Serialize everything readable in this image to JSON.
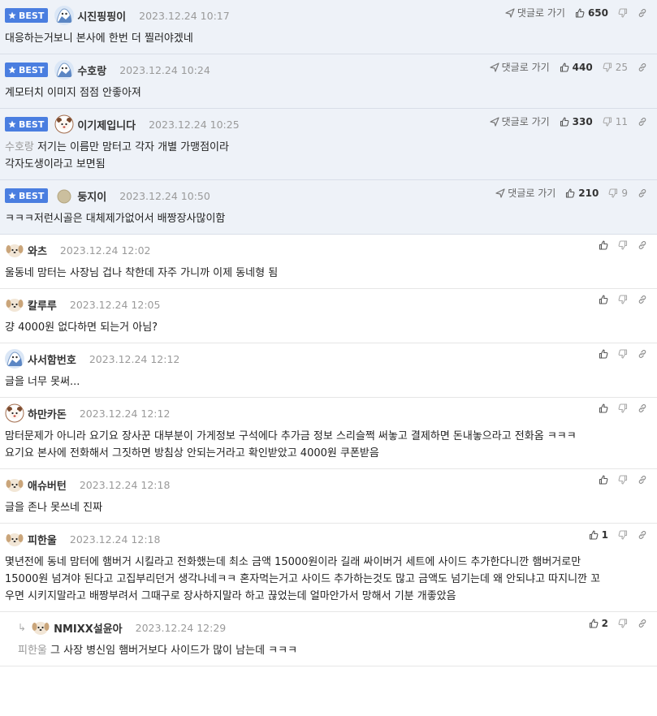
{
  "labels": {
    "best": "BEST",
    "goto_reply": "댓글로 가기"
  },
  "comments": [
    {
      "best": true,
      "avatar": "avatar-blue",
      "nick": "시진핑핑이",
      "date": "2023.12.24 10:17",
      "up": "650",
      "down": "",
      "mention": "",
      "lines": [
        "대응하는거보니 본사에 한번 더 찔러야겠네"
      ]
    },
    {
      "best": true,
      "avatar": "avatar-blue",
      "nick": "수호랑",
      "date": "2023.12.24 10:24",
      "up": "440",
      "down": "25",
      "mention": "",
      "lines": [
        "계모터치 이미지 점점 안좋아져"
      ]
    },
    {
      "best": true,
      "avatar": "avatar-white",
      "nick": "이기제입니다",
      "date": "2023.12.24 10:25",
      "up": "330",
      "down": "11",
      "mention": "수호랑",
      "lines": [
        "저기는 이름만 맘터고 각자 개별 가맹점이라",
        "각자도생이라고 보면됨"
      ]
    },
    {
      "best": true,
      "avatar": "avatar-beige",
      "nick": "둥지이",
      "date": "2023.12.24 10:50",
      "up": "210",
      "down": "9",
      "mention": "",
      "lines": [
        "ㅋㅋㅋ저런시골은 대체제가없어서 배짱장사많이함"
      ]
    },
    {
      "best": false,
      "avatar": "avatar-dog",
      "nick": "와츠",
      "date": "2023.12.24 12:02",
      "up": "",
      "down": "",
      "mention": "",
      "lines": [
        "울동네 맘터는 사장님 겁나 착한데 자주 가니까 이제 동네형 됨"
      ]
    },
    {
      "best": false,
      "avatar": "avatar-dog",
      "nick": "칼루루",
      "date": "2023.12.24 12:05",
      "up": "",
      "down": "",
      "mention": "",
      "lines": [
        "걍 4000원 없다하면 되는거 아님?"
      ]
    },
    {
      "best": false,
      "avatar": "avatar-blue",
      "nick": "사서함번호",
      "date": "2023.12.24 12:12",
      "up": "",
      "down": "",
      "mention": "",
      "lines": [
        "글을 너무 못써..."
      ]
    },
    {
      "best": false,
      "avatar": "avatar-white",
      "nick": "하만카돈",
      "date": "2023.12.24 12:12",
      "up": "",
      "down": "",
      "mention": "",
      "lines": [
        "맘터문제가 아니라 요기요 장사꾼 대부분이 가게정보 구석에다 추가금 정보 스리슬쩍 써놓고 결제하면 돈내놓으라고 전화옴 ㅋㅋㅋ",
        "요기요 본사에 전화해서 그짓하면 방침상 안되는거라고 확인받았고 4000원 쿠폰받음"
      ]
    },
    {
      "best": false,
      "avatar": "avatar-dog",
      "nick": "애슈버턴",
      "date": "2023.12.24 12:18",
      "up": "",
      "down": "",
      "mention": "",
      "lines": [
        "글을 존나 못쓰네 진짜"
      ]
    },
    {
      "best": false,
      "avatar": "avatar-dog",
      "nick": "피한울",
      "date": "2023.12.24 12:18",
      "up": "1",
      "down": "",
      "mention": "",
      "lines": [
        "몇년전에 동네 맘터에 햄버거 시킬라고 전화했는데 최소 금액 15000원이라 길래 싸이버거 세트에 사이드 추가한다니깐 햄버거로만",
        "15000원 넘겨야 된다고 고집부리던거 생각나네ㅋㅋ 혼자먹는거고 사이드 추가하는것도 많고 금액도 넘기는데 왜 안되냐고 따지니깐 꼬",
        "우면 시키지말라고 배짱부려서 그때구로 장사하지말라 하고 끊었는데 얼마안가서 망해서 기분 개좋았음"
      ]
    },
    {
      "best": false,
      "reply": true,
      "avatar": "avatar-dog",
      "nick": "NMIXX설윤아",
      "date": "2023.12.24 12:29",
      "up": "2",
      "down": "",
      "mention": "피한울",
      "lines": [
        "그 사장 병신임 햄버거보다 사이드가 많이 남는데 ㅋㅋㅋ"
      ]
    }
  ],
  "colors": {
    "best_badge": "#4a7ee0",
    "best_row_bg": "#eef2f8",
    "muted": "#9a9a9a"
  }
}
